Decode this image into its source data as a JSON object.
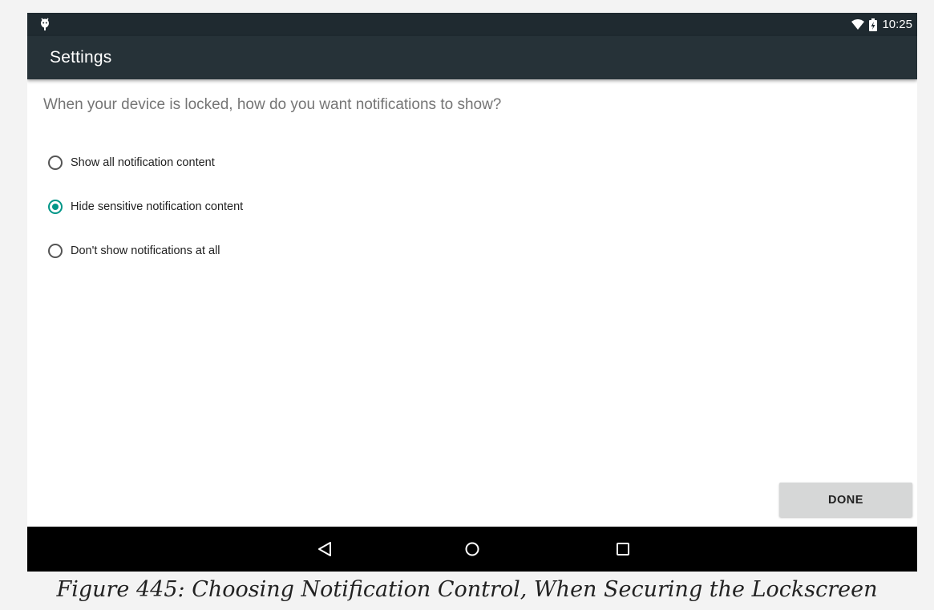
{
  "status_bar": {
    "time": "10:25",
    "left_icon": "android-debug-icon",
    "wifi_icon": "wifi-icon",
    "battery_icon": "battery-charging-icon"
  },
  "app_bar": {
    "title": "Settings"
  },
  "content": {
    "prompt": "When your device is locked, how do you want notifications to show?",
    "options": [
      {
        "label": "Show all notification content",
        "selected": false
      },
      {
        "label": "Hide sensitive notification content",
        "selected": true
      },
      {
        "label": "Don't show notifications at all",
        "selected": false
      }
    ],
    "done_label": "DONE"
  },
  "nav_bar": {
    "back_icon": "back-triangle-icon",
    "home_icon": "home-circle-icon",
    "recents_icon": "recents-square-icon"
  },
  "caption": "Figure 445: Choosing Notification Control, When Securing the Lockscreen",
  "colors": {
    "app_bar": "#263238",
    "status_bar": "#1f2a30",
    "accent": "#009688",
    "button": "#d6d7d7"
  }
}
